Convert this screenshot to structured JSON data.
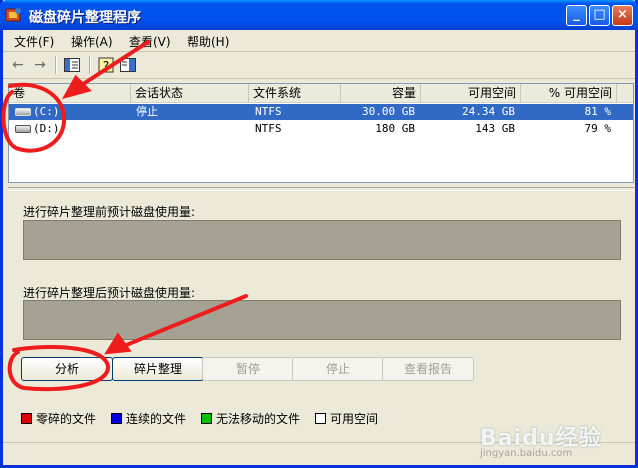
{
  "window": {
    "title": "磁盘碎片整理程序",
    "controls": {
      "minimize": "_",
      "maximize": "□",
      "close": "×"
    }
  },
  "menu": [
    "文件(F)",
    "操作(A)",
    "查看(V)",
    "帮助(H)"
  ],
  "toolbar": {
    "icons": [
      "back-arrow-icon",
      "forward-arrow-icon",
      "console-tree-icon",
      "help-icon",
      "properties-icon"
    ]
  },
  "volume_list": {
    "columns": [
      "卷",
      "会话状态",
      "文件系统",
      "容量",
      "可用空间",
      "% 可用空间"
    ],
    "rows": [
      {
        "volume": "(C:)",
        "status": "停止",
        "fs": "NTFS",
        "capacity": "30.00 GB",
        "free": "24.34 GB",
        "pct": "81 %",
        "selected": true
      },
      {
        "volume": "(D:)",
        "status": "",
        "fs": "NTFS",
        "capacity": "180 GB",
        "free": "143 GB",
        "pct": "79 %",
        "selected": false
      }
    ]
  },
  "usage": {
    "before_label": "进行碎片整理前预计磁盘使用量:",
    "after_label": "进行碎片整理后预计磁盘使用量:"
  },
  "buttons": {
    "analyze": "分析",
    "defragment": "碎片整理",
    "pause": "暂停",
    "stop": "停止",
    "view_report": "查看报告"
  },
  "legend": [
    {
      "label": "零碎的文件",
      "color": "#e00000"
    },
    {
      "label": "连续的文件",
      "color": "#0000e0"
    },
    {
      "label": "无法移动的文件",
      "color": "#00c000"
    },
    {
      "label": "可用空间",
      "color": "#ffffff"
    }
  ],
  "annotation": {
    "color": "#ee1c1c"
  },
  "watermark": {
    "brand": "Baidu经验",
    "url": "jingyan.baidu.com"
  }
}
